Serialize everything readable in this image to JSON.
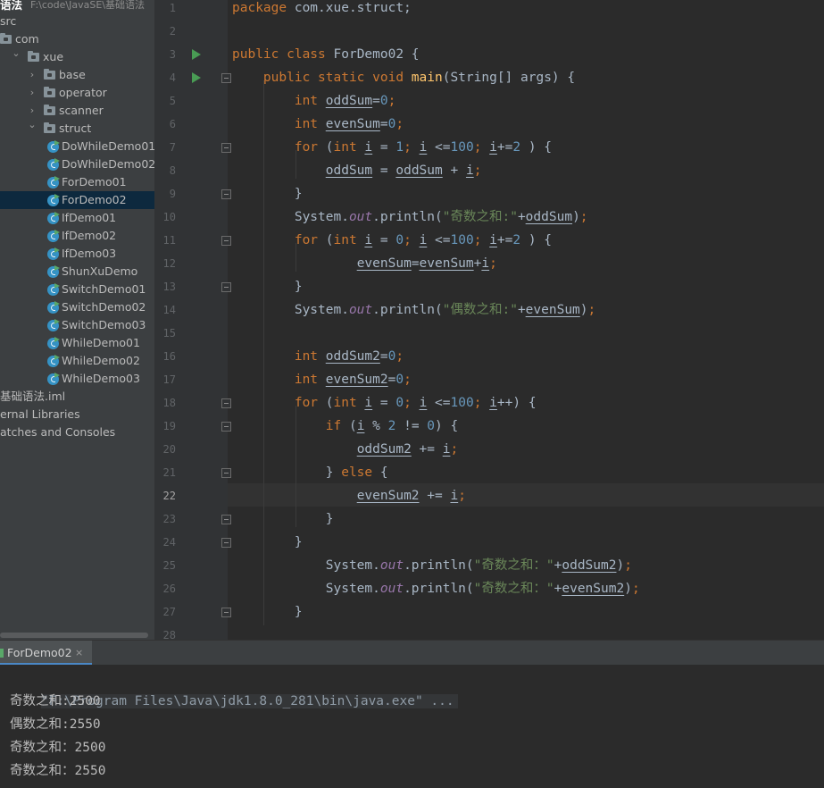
{
  "project": {
    "title": "语法",
    "path": "F:\\code\\JavaSE\\基础语法",
    "tree": [
      {
        "label": "src",
        "type": "folder-plain",
        "indent": 0
      },
      {
        "label": "com",
        "type": "folder",
        "indent": 0
      },
      {
        "label": "xue",
        "type": "folder",
        "indent": 1,
        "expanded": true
      },
      {
        "label": "base",
        "type": "folder",
        "indent": 2,
        "expanded": false
      },
      {
        "label": "operator",
        "type": "folder",
        "indent": 2,
        "expanded": false
      },
      {
        "label": "scanner",
        "type": "folder",
        "indent": 2,
        "expanded": false
      },
      {
        "label": "struct",
        "type": "folder",
        "indent": 2,
        "expanded": true
      },
      {
        "label": "DoWhileDemo01",
        "type": "class",
        "indent": 3
      },
      {
        "label": "DoWhileDemo02",
        "type": "class",
        "indent": 3
      },
      {
        "label": "ForDemo01",
        "type": "class",
        "indent": 3
      },
      {
        "label": "ForDemo02",
        "type": "class",
        "indent": 3,
        "selected": true
      },
      {
        "label": "IfDemo01",
        "type": "class",
        "indent": 3
      },
      {
        "label": "IfDemo02",
        "type": "class",
        "indent": 3
      },
      {
        "label": "IfDemo03",
        "type": "class",
        "indent": 3
      },
      {
        "label": "ShunXuDemo",
        "type": "class",
        "indent": 3
      },
      {
        "label": "SwitchDemo01",
        "type": "class",
        "indent": 3
      },
      {
        "label": "SwitchDemo02",
        "type": "class",
        "indent": 3
      },
      {
        "label": "SwitchDemo03",
        "type": "class",
        "indent": 3
      },
      {
        "label": "WhileDemo01",
        "type": "class",
        "indent": 3
      },
      {
        "label": "WhileDemo02",
        "type": "class",
        "indent": 3
      },
      {
        "label": "WhileDemo03",
        "type": "class",
        "indent": 3
      },
      {
        "label": "基础语法.iml",
        "type": "file",
        "indent": 0
      },
      {
        "label": "ernal Libraries",
        "type": "text",
        "indent": 0
      },
      {
        "label": "atches and Consoles",
        "type": "text",
        "indent": 0
      }
    ]
  },
  "editor": {
    "current_line": 22,
    "line_numbers": [
      "1",
      "2",
      "3",
      "4",
      "5",
      "6",
      "7",
      "8",
      "9",
      "10",
      "11",
      "12",
      "13",
      "14",
      "15",
      "16",
      "17",
      "18",
      "19",
      "20",
      "21",
      "22",
      "23",
      "24",
      "25",
      "26",
      "27",
      "28"
    ],
    "run_markers": [
      3,
      4
    ],
    "fold_markers": [
      4,
      7,
      9,
      11,
      13,
      18,
      19,
      21,
      23,
      24,
      27
    ],
    "lines": [
      [
        [
          "kw",
          "package "
        ],
        [
          "",
          "com.xue.struct;"
        ]
      ],
      [],
      [
        [
          "kw",
          "public class "
        ],
        [
          "",
          "ForDemo02 {"
        ]
      ],
      [
        [
          "",
          "    "
        ],
        [
          "kw",
          "public static void "
        ],
        [
          "fn",
          "main"
        ],
        [
          "",
          "(String[] args) {"
        ]
      ],
      [
        [
          "",
          "        "
        ],
        [
          "kw",
          "int "
        ],
        [
          "var",
          "oddSum"
        ],
        [
          "",
          "="
        ],
        [
          "num",
          "0"
        ],
        [
          "kw",
          ";"
        ]
      ],
      [
        [
          "",
          "        "
        ],
        [
          "kw",
          "int "
        ],
        [
          "var",
          "evenSum"
        ],
        [
          "",
          "="
        ],
        [
          "num",
          "0"
        ],
        [
          "kw",
          ";"
        ]
      ],
      [
        [
          "",
          "        "
        ],
        [
          "kw",
          "for "
        ],
        [
          "",
          "("
        ],
        [
          "kw",
          "int "
        ],
        [
          "var",
          "i"
        ],
        [
          "",
          " = "
        ],
        [
          "num",
          "1"
        ],
        [
          "kw",
          "; "
        ],
        [
          "var",
          "i"
        ],
        [
          "",
          " <="
        ],
        [
          "num",
          "100"
        ],
        [
          "kw",
          "; "
        ],
        [
          "var",
          "i"
        ],
        [
          "",
          "+="
        ],
        [
          "num",
          "2"
        ],
        [
          "",
          " ) {"
        ]
      ],
      [
        [
          "",
          "            "
        ],
        [
          "var",
          "oddSum"
        ],
        [
          "",
          " = "
        ],
        [
          "var",
          "oddSum"
        ],
        [
          "",
          " + "
        ],
        [
          "var",
          "i"
        ],
        [
          "kw",
          ";"
        ]
      ],
      [
        [
          "",
          "        }"
        ]
      ],
      [
        [
          "",
          "        System."
        ],
        [
          "field",
          "out"
        ],
        [
          "",
          ".println("
        ],
        [
          "str",
          "\"奇数之和:\""
        ],
        [
          "",
          "+"
        ],
        [
          "var",
          "oddSum"
        ],
        [
          "",
          ")"
        ],
        [
          "kw",
          ";"
        ]
      ],
      [
        [
          "",
          "        "
        ],
        [
          "kw",
          "for "
        ],
        [
          "",
          "("
        ],
        [
          "kw",
          "int "
        ],
        [
          "var",
          "i"
        ],
        [
          "",
          " = "
        ],
        [
          "num",
          "0"
        ],
        [
          "kw",
          "; "
        ],
        [
          "var",
          "i"
        ],
        [
          "",
          " <="
        ],
        [
          "num",
          "100"
        ],
        [
          "kw",
          "; "
        ],
        [
          "var",
          "i"
        ],
        [
          "",
          "+="
        ],
        [
          "num",
          "2"
        ],
        [
          "",
          " ) {"
        ]
      ],
      [
        [
          "",
          "                "
        ],
        [
          "var",
          "evenSum"
        ],
        [
          "",
          "="
        ],
        [
          "var",
          "evenSum"
        ],
        [
          "",
          "+"
        ],
        [
          "var",
          "i"
        ],
        [
          "kw",
          ";"
        ]
      ],
      [
        [
          "",
          "        }"
        ]
      ],
      [
        [
          "",
          "        System."
        ],
        [
          "field",
          "out"
        ],
        [
          "",
          ".println("
        ],
        [
          "str",
          "\"偶数之和:\""
        ],
        [
          "",
          "+"
        ],
        [
          "var",
          "evenSum"
        ],
        [
          "",
          ")"
        ],
        [
          "kw",
          ";"
        ]
      ],
      [],
      [
        [
          "",
          "        "
        ],
        [
          "kw",
          "int "
        ],
        [
          "var",
          "oddSum2"
        ],
        [
          "",
          "="
        ],
        [
          "num",
          "0"
        ],
        [
          "kw",
          ";"
        ]
      ],
      [
        [
          "",
          "        "
        ],
        [
          "kw",
          "int "
        ],
        [
          "var",
          "evenSum2"
        ],
        [
          "",
          "="
        ],
        [
          "num",
          "0"
        ],
        [
          "kw",
          ";"
        ]
      ],
      [
        [
          "",
          "        "
        ],
        [
          "kw",
          "for "
        ],
        [
          "",
          "("
        ],
        [
          "kw",
          "int "
        ],
        [
          "var",
          "i"
        ],
        [
          "",
          " = "
        ],
        [
          "num",
          "0"
        ],
        [
          "kw",
          "; "
        ],
        [
          "var",
          "i"
        ],
        [
          "",
          " <="
        ],
        [
          "num",
          "100"
        ],
        [
          "kw",
          "; "
        ],
        [
          "var",
          "i"
        ],
        [
          "",
          "++) {"
        ]
      ],
      [
        [
          "",
          "            "
        ],
        [
          "kw",
          "if "
        ],
        [
          "",
          "("
        ],
        [
          "var",
          "i"
        ],
        [
          "",
          " % "
        ],
        [
          "num",
          "2"
        ],
        [
          "",
          " != "
        ],
        [
          "num",
          "0"
        ],
        [
          "",
          ") {"
        ]
      ],
      [
        [
          "",
          "                "
        ],
        [
          "var",
          "oddSum2"
        ],
        [
          "",
          " += "
        ],
        [
          "var",
          "i"
        ],
        [
          "kw",
          ";"
        ]
      ],
      [
        [
          "",
          "            } "
        ],
        [
          "kw",
          "else "
        ],
        [
          "",
          "{"
        ]
      ],
      [
        [
          "",
          "                "
        ],
        [
          "var",
          "evenSum2"
        ],
        [
          "",
          " += "
        ],
        [
          "var",
          "i"
        ],
        [
          "kw",
          ";"
        ]
      ],
      [
        [
          "",
          "            }"
        ]
      ],
      [
        [
          "",
          "        }"
        ]
      ],
      [
        [
          "",
          "            System."
        ],
        [
          "field",
          "out"
        ],
        [
          "",
          ".println("
        ],
        [
          "str",
          "\"奇数之和：\""
        ],
        [
          "",
          "+"
        ],
        [
          "var",
          "oddSum2"
        ],
        [
          "",
          ")"
        ],
        [
          "kw",
          ";"
        ]
      ],
      [
        [
          "",
          "            System."
        ],
        [
          "field",
          "out"
        ],
        [
          "",
          ".println("
        ],
        [
          "str",
          "\"奇数之和：\""
        ],
        [
          "",
          "+"
        ],
        [
          "var",
          "evenSum2"
        ],
        [
          "",
          ")"
        ],
        [
          "kw",
          ";"
        ]
      ],
      [
        [
          "",
          "        }"
        ]
      ],
      []
    ]
  },
  "run_panel": {
    "tab_label": "ForDemo02",
    "close_glyph": "×",
    "command": "\"F:\\Program Files\\Java\\jdk1.8.0_281\\bin\\java.exe\" ...",
    "output": [
      "奇数之和:2500",
      "偶数之和:2550",
      "奇数之和：2500",
      "奇数之和：2550"
    ]
  }
}
